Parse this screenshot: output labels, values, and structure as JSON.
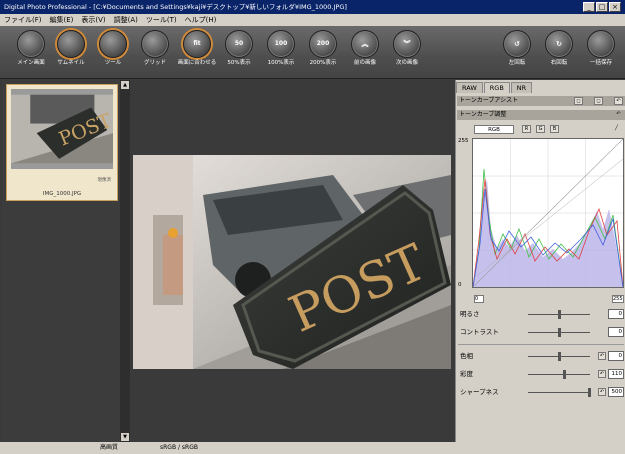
{
  "window": {
    "title": "Digital Photo Professional - [C:¥Documents and Settings¥kaji¥デスクトップ¥新しいフォルダ¥IMG_1000.JPG]"
  },
  "title_buttons": [
    "_",
    "□",
    "×"
  ],
  "menu": [
    "ファイル(F)",
    "編集(E)",
    "表示(V)",
    "調整(A)",
    "ツール(T)",
    "ヘルプ(H)"
  ],
  "toolbar": [
    {
      "label": "メイン画面",
      "icon": "main-window-icon",
      "glyph": ""
    },
    {
      "label": "サムネイル",
      "icon": "thumbnail-icon",
      "glyph": ""
    },
    {
      "label": "ツール",
      "icon": "tool-icon",
      "glyph": ""
    },
    {
      "label": "グリッド",
      "icon": "grid-icon",
      "glyph": ""
    },
    {
      "label": "画面に合わせる",
      "icon": "fit-screen-icon",
      "glyph": "fit"
    },
    {
      "label": "50%表示",
      "icon": "zoom-50-icon",
      "glyph": "50"
    },
    {
      "label": "100%表示",
      "icon": "zoom-100-icon",
      "glyph": "100"
    },
    {
      "label": "200%表示",
      "icon": "zoom-200-icon",
      "glyph": "200"
    },
    {
      "label": "前の画像",
      "icon": "previous-image-icon",
      "glyph": "︽"
    },
    {
      "label": "次の画像",
      "icon": "next-image-icon",
      "glyph": "︾"
    },
    {
      "label": "左回転",
      "icon": "rotate-left-icon",
      "glyph": "↺"
    },
    {
      "label": "右回転",
      "icon": "rotate-right-icon",
      "glyph": "↻"
    },
    {
      "label": "一括保存",
      "icon": "batch-save-icon",
      "glyph": ""
    }
  ],
  "thumbnail": {
    "filename": "IMG_1000.JPG",
    "rated": "現像済"
  },
  "photo": {
    "sign_text": "POST"
  },
  "panel": {
    "tabs": [
      "RAW",
      "RGB",
      "NR"
    ],
    "active_tab": "RGB",
    "tone_assist": "トーンカーブアシスト",
    "tone_adjust": "トーンカーブ調整",
    "channel": "RGB",
    "channel_buttons": [
      "R",
      "G",
      "B"
    ],
    "axis_top": "255",
    "axis_bottom": "0",
    "input_low": "0",
    "input_high": "255",
    "sliders": [
      {
        "label": "明るさ",
        "value": "0",
        "pos": 0.5
      },
      {
        "label": "コントラスト",
        "value": "0",
        "pos": 0.5
      }
    ],
    "sliders2": [
      {
        "label": "色相",
        "value": "0",
        "pos": 0.5
      },
      {
        "label": "彩度",
        "value": "110",
        "pos": 0.58
      },
      {
        "label": "シャープネス",
        "value": "500",
        "pos": 1.0
      }
    ]
  },
  "status": {
    "quality": "高画質",
    "colorspace": "sRGB / sRGB"
  }
}
